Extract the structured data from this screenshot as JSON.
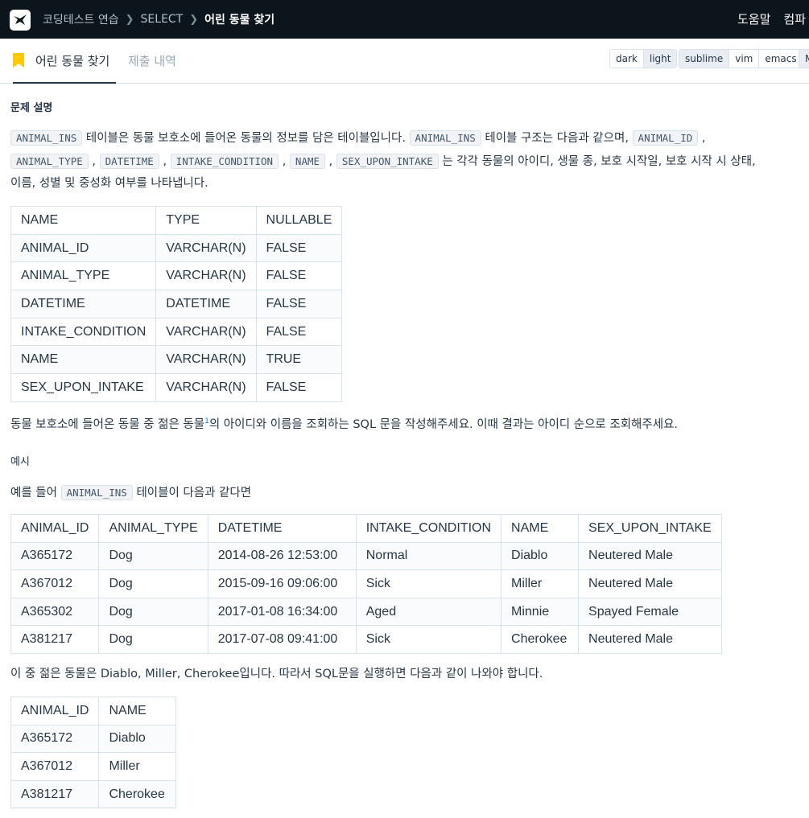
{
  "nav": {
    "breadcrumb": [
      "코딩테스트 연습",
      "SELECT",
      "어린 동물 찾기"
    ],
    "right_links": [
      "도움말",
      "컴파"
    ]
  },
  "tabs": {
    "active": "어린 동물 찾기",
    "inactive": "제출 내역"
  },
  "themes": [
    "dark",
    "light"
  ],
  "editors": [
    "sublime",
    "vim",
    "emacs"
  ],
  "cutoff_button": "M",
  "colors": {
    "nav_bg": "#0c151c",
    "bookmark": "#ffc800"
  },
  "content": {
    "section_title": "문제 설명",
    "desc": {
      "p1_code1": "ANIMAL_INS",
      "p1_text1": " 테이블은 동물 보호소에 들어온 동물의 정보를 담은 테이블입니다. ",
      "p1_code2": "ANIMAL_INS",
      "p1_text2": " 테이블 구조는 다음과 같으며, ",
      "p1_code3": "ANIMAL_ID",
      "p1_text3": " ,",
      "p2_code1": "ANIMAL_TYPE",
      "p2_code2": "DATETIME",
      "p2_code3": "INTAKE_CONDITION",
      "p2_code4": "NAME",
      "p2_code5": "SEX_UPON_INTAKE",
      "p2_text": " 는 각각 동물의 아이디, 생물 종, 보호 시작일, 보호 시작 시 상태,",
      "p3_text": "이름, 성별 및 중성화 여부를 나타냅니다.",
      "comma": " , "
    },
    "schema_table": {
      "headers": [
        "NAME",
        "TYPE",
        "NULLABLE"
      ],
      "rows": [
        [
          "ANIMAL_ID",
          "VARCHAR(N)",
          "FALSE"
        ],
        [
          "ANIMAL_TYPE",
          "VARCHAR(N)",
          "FALSE"
        ],
        [
          "DATETIME",
          "DATETIME",
          "FALSE"
        ],
        [
          "INTAKE_CONDITION",
          "VARCHAR(N)",
          "FALSE"
        ],
        [
          "NAME",
          "VARCHAR(N)",
          "TRUE"
        ],
        [
          "SEX_UPON_INTAKE",
          "VARCHAR(N)",
          "FALSE"
        ]
      ]
    },
    "question_pre": "동물 보호소에 들어온 동물 중 젊은 동물",
    "question_sup": "1",
    "question_post": "의 아이디와 이름을 조회하는 SQL 문을 작성해주세요. 이때 결과는 아이디 순으로 조회해주세요.",
    "example_title": "예시",
    "example_pre": "예를 들어 ",
    "example_code": "ANIMAL_INS",
    "example_post": " 테이블이 다음과 같다면",
    "example_table": {
      "headers": [
        "ANIMAL_ID",
        "ANIMAL_TYPE",
        "DATETIME",
        "INTAKE_CONDITION",
        "NAME",
        "SEX_UPON_INTAKE"
      ],
      "rows": [
        [
          "A365172",
          "Dog",
          "2014-08-26 12:53:00",
          "Normal",
          "Diablo",
          "Neutered Male"
        ],
        [
          "A367012",
          "Dog",
          "2015-09-16 09:06:00",
          "Sick",
          "Miller",
          "Neutered Male"
        ],
        [
          "A365302",
          "Dog",
          "2017-01-08 16:34:00",
          "Aged",
          "Minnie",
          "Spayed Female"
        ],
        [
          "A381217",
          "Dog",
          "2017-07-08 09:41:00",
          "Sick",
          "Cherokee",
          "Neutered Male"
        ]
      ]
    },
    "result_text": "이 중 젊은 동물은 Diablo, Miller, Cherokee입니다. 따라서 SQL문을 실행하면 다음과 같이 나와야 합니다.",
    "result_table": {
      "headers": [
        "ANIMAL_ID",
        "NAME"
      ],
      "rows": [
        [
          "A365172",
          "Diablo"
        ],
        [
          "A367012",
          "Miller"
        ],
        [
          "A381217",
          "Cherokee"
        ]
      ]
    }
  }
}
